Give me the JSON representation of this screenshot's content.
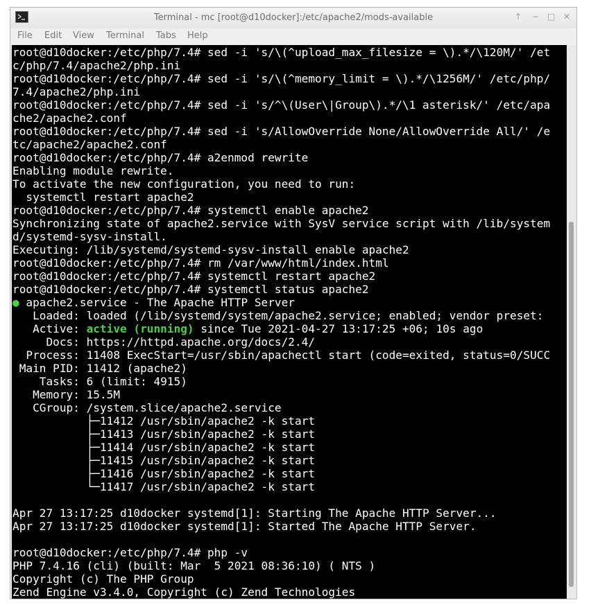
{
  "window": {
    "title": "Terminal - mc [root@d10docker]:/etc/apache2/mods-available",
    "buttons": {
      "up": "↑",
      "minimize": "−",
      "maximize": "□",
      "close": "✕"
    }
  },
  "menu": {
    "items": [
      "File",
      "Edit",
      "View",
      "Terminal",
      "Tabs",
      "Help"
    ]
  },
  "terminal": {
    "bullet": "●",
    "status_active": "active (running)",
    "lines": [
      "root@d10docker:/etc/php/7.4# sed -i 's/\\(^upload_max_filesize = \\).*/\\120M/' /et",
      "c/php/7.4/apache2/php.ini",
      "root@d10docker:/etc/php/7.4# sed -i 's/\\(^memory_limit = \\).*/\\1256M/' /etc/php/",
      "7.4/apache2/php.ini",
      "root@d10docker:/etc/php/7.4# sed -i 's/^\\(User\\|Group\\).*/\\1 asterisk/' /etc/apa",
      "che2/apache2.conf",
      "root@d10docker:/etc/php/7.4# sed -i 's/AllowOverride None/AllowOverride All/' /e",
      "tc/apache2/apache2.conf",
      "root@d10docker:/etc/php/7.4# a2enmod rewrite",
      "Enabling module rewrite.",
      "To activate the new configuration, you need to run:",
      "  systemctl restart apache2",
      "root@d10docker:/etc/php/7.4# systemctl enable apache2",
      "Synchronizing state of apache2.service with SysV service script with /lib/system",
      "d/systemd-sysv-install.",
      "Executing: /lib/systemd/systemd-sysv-install enable apache2",
      "root@d10docker:/etc/php/7.4# rm /var/www/html/index.html",
      "root@d10docker:/etc/php/7.4# systemctl restart apache2",
      "root@d10docker:/etc/php/7.4# systemctl status apache2",
      " apache2.service - The Apache HTTP Server",
      "   Loaded: loaded (/lib/systemd/system/apache2.service; enabled; vendor preset:",
      "   Active: ",
      "     Docs: https://httpd.apache.org/docs/2.4/",
      "  Process: 11408 ExecStart=/usr/sbin/apachectl start (code=exited, status=0/SUCC",
      " Main PID: 11412 (apache2)",
      "    Tasks: 6 (limit: 4915)",
      "   Memory: 15.5M",
      "   CGroup: /system.slice/apache2.service",
      "           ├─11412 /usr/sbin/apache2 -k start",
      "           ├─11413 /usr/sbin/apache2 -k start",
      "           ├─11414 /usr/sbin/apache2 -k start",
      "           ├─11415 /usr/sbin/apache2 -k start",
      "           ├─11416 /usr/sbin/apache2 -k start",
      "           └─11417 /usr/sbin/apache2 -k start",
      "",
      "Apr 27 13:17:25 d10docker systemd[1]: Starting The Apache HTTP Server...",
      "Apr 27 13:17:25 d10docker systemd[1]: Started The Apache HTTP Server.",
      "",
      "root@d10docker:/etc/php/7.4# php -v",
      "PHP 7.4.16 (cli) (built: Mar  5 2021 08:36:10) ( NTS )",
      "Copyright (c) The PHP Group",
      "Zend Engine v3.4.0, Copyright (c) Zend Technologies"
    ],
    "active_suffix": " since Tue 2021-04-27 13:17:25 +06; 10s ago"
  },
  "colors": {
    "terminal_bg": "#000000",
    "terminal_fg": "#ffffff",
    "active_green": "#44d344"
  }
}
